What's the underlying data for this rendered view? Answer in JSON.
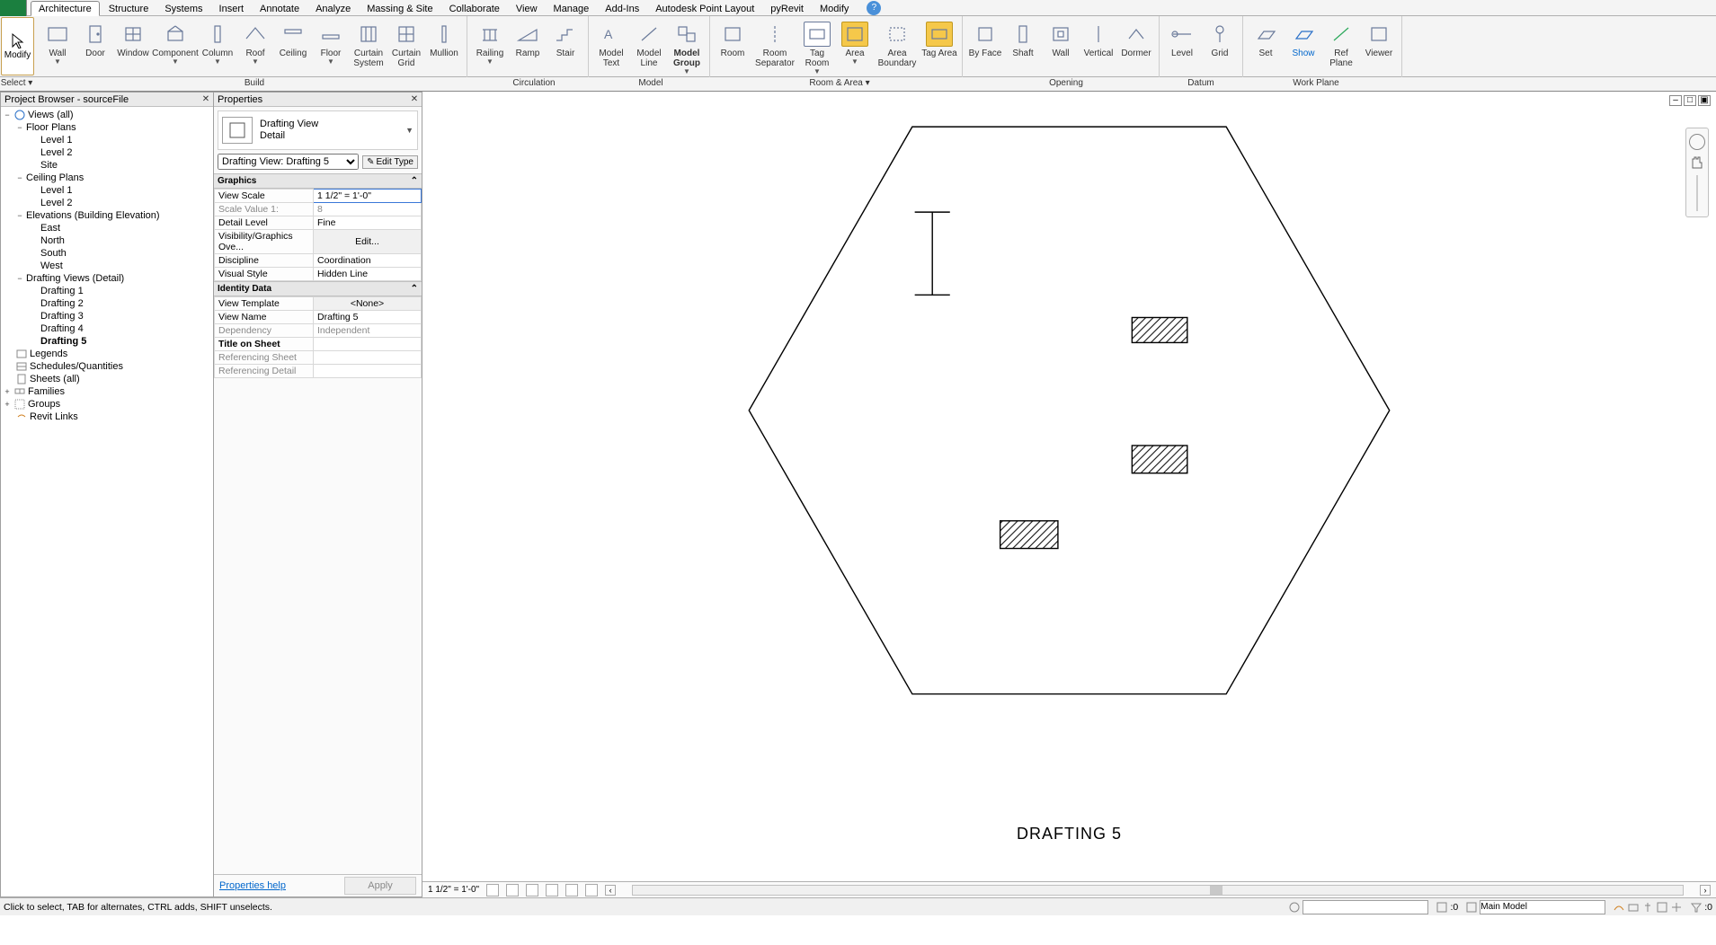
{
  "ribbon": {
    "tabs": [
      "Architecture",
      "Structure",
      "Systems",
      "Insert",
      "Annotate",
      "Analyze",
      "Massing & Site",
      "Collaborate",
      "View",
      "Manage",
      "Add-Ins",
      "Autodesk Point Layout",
      "pyRevit",
      "Modify"
    ],
    "active_tab": "Architecture",
    "select": {
      "label": "Modify",
      "panel_label": "Select ▾"
    },
    "groups": {
      "build": {
        "label": "Build",
        "items": [
          "Wall",
          "Door",
          "Window",
          "Component",
          "Column",
          "Roof",
          "Ceiling",
          "Floor",
          "Curtain System",
          "Curtain Grid",
          "Mullion"
        ]
      },
      "circulation": {
        "label": "Circulation",
        "items": [
          "Railing",
          "Ramp",
          "Stair"
        ]
      },
      "model": {
        "label": "Model",
        "items": [
          "Model Text",
          "Model Line",
          "Model Group"
        ]
      },
      "room_area": {
        "label": "Room & Area ▾",
        "items": [
          "Room",
          "Room Separator",
          "Tag Room",
          "Area",
          "Area Boundary",
          "Tag Area"
        ]
      },
      "opening": {
        "label": "Opening",
        "items": [
          "By Face",
          "Shaft",
          "Wall",
          "Vertical",
          "Dormer"
        ]
      },
      "datum": {
        "label": "Datum",
        "items": [
          "Level",
          "Grid"
        ]
      },
      "work_plane": {
        "label": "Work Plane",
        "items": [
          "Set",
          "Show",
          "Ref Plane",
          "Viewer"
        ]
      }
    }
  },
  "project_browser": {
    "title": "Project Browser - sourceFile",
    "views_root": "Views (all)",
    "floor_plans": {
      "label": "Floor Plans",
      "children": [
        "Level 1",
        "Level 2",
        "Site"
      ]
    },
    "ceiling_plans": {
      "label": "Ceiling Plans",
      "children": [
        "Level 1",
        "Level 2"
      ]
    },
    "elevations": {
      "label": "Elevations (Building Elevation)",
      "children": [
        "East",
        "North",
        "South",
        "West"
      ]
    },
    "drafting": {
      "label": "Drafting Views (Detail)",
      "children": [
        "Drafting 1",
        "Drafting 2",
        "Drafting 3",
        "Drafting 4",
        "Drafting 5"
      ],
      "active": "Drafting 5"
    },
    "others": [
      "Legends",
      "Schedules/Quantities",
      "Sheets (all)",
      "Families",
      "Groups",
      "Revit Links"
    ]
  },
  "properties": {
    "title": "Properties",
    "type_name": "Drafting View",
    "type_sub": "Detail",
    "instance_selector": "Drafting View: Drafting 5",
    "edit_type": "Edit Type",
    "graphics": {
      "section": "Graphics",
      "view_scale": {
        "k": "View Scale",
        "v": "1 1/2\" = 1'-0\""
      },
      "scale_value": {
        "k": "Scale Value    1:",
        "v": "8"
      },
      "detail_level": {
        "k": "Detail Level",
        "v": "Fine"
      },
      "vis": {
        "k": "Visibility/Graphics Ove...",
        "v": "Edit..."
      },
      "discipline": {
        "k": "Discipline",
        "v": "Coordination"
      },
      "visual_style": {
        "k": "Visual Style",
        "v": "Hidden Line"
      }
    },
    "identity": {
      "section": "Identity Data",
      "view_template": {
        "k": "View Template",
        "v": "<None>"
      },
      "view_name": {
        "k": "View Name",
        "v": "Drafting 5"
      },
      "dependency": {
        "k": "Dependency",
        "v": "Independent"
      },
      "title_on_sheet": {
        "k": "Title on Sheet",
        "v": ""
      },
      "ref_sheet": {
        "k": "Referencing Sheet",
        "v": ""
      },
      "ref_detail": {
        "k": "Referencing Detail",
        "v": ""
      }
    },
    "help": "Properties help",
    "apply": "Apply"
  },
  "canvas": {
    "view_title": "DRAFTING 5",
    "viewbar_scale": "1 1/2\" = 1'-0\""
  },
  "status": {
    "hint": "Click to select, TAB for alternates, CTRL adds, SHIFT unselects.",
    "sel_count": ":0",
    "filter_count": ":0",
    "workset": "Main Model"
  }
}
